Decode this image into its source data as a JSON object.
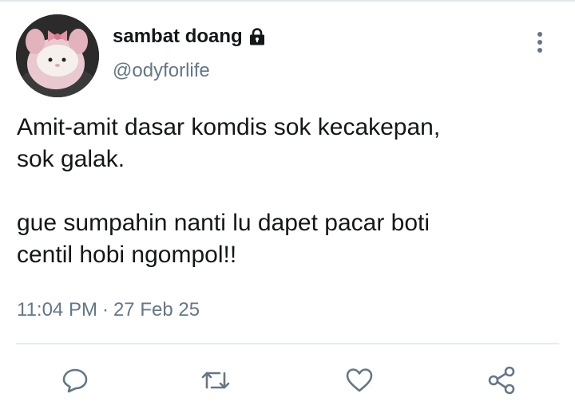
{
  "tweet": {
    "display_name": "sambat doang",
    "handle": "@odyforlife",
    "protected_icon": "lock-icon",
    "text_lines_1": [
      "Amit-amit dasar komdis sok kecakepan,",
      "sok galak."
    ],
    "text_lines_2": [
      "gue sumpahin nanti lu dapet pacar boti",
      "centil hobi ngompol!!"
    ],
    "time": "11:04 PM",
    "separator": "·",
    "date": "27 Feb 25"
  },
  "actions": {
    "reply_icon": "reply-icon",
    "retweet_icon": "retweet-icon",
    "like_icon": "heart-icon",
    "share_icon": "share-icon"
  },
  "colors": {
    "text_primary": "#14171a",
    "text_secondary": "#657786",
    "icon": "#657786",
    "divider": "#e6ecf0"
  }
}
